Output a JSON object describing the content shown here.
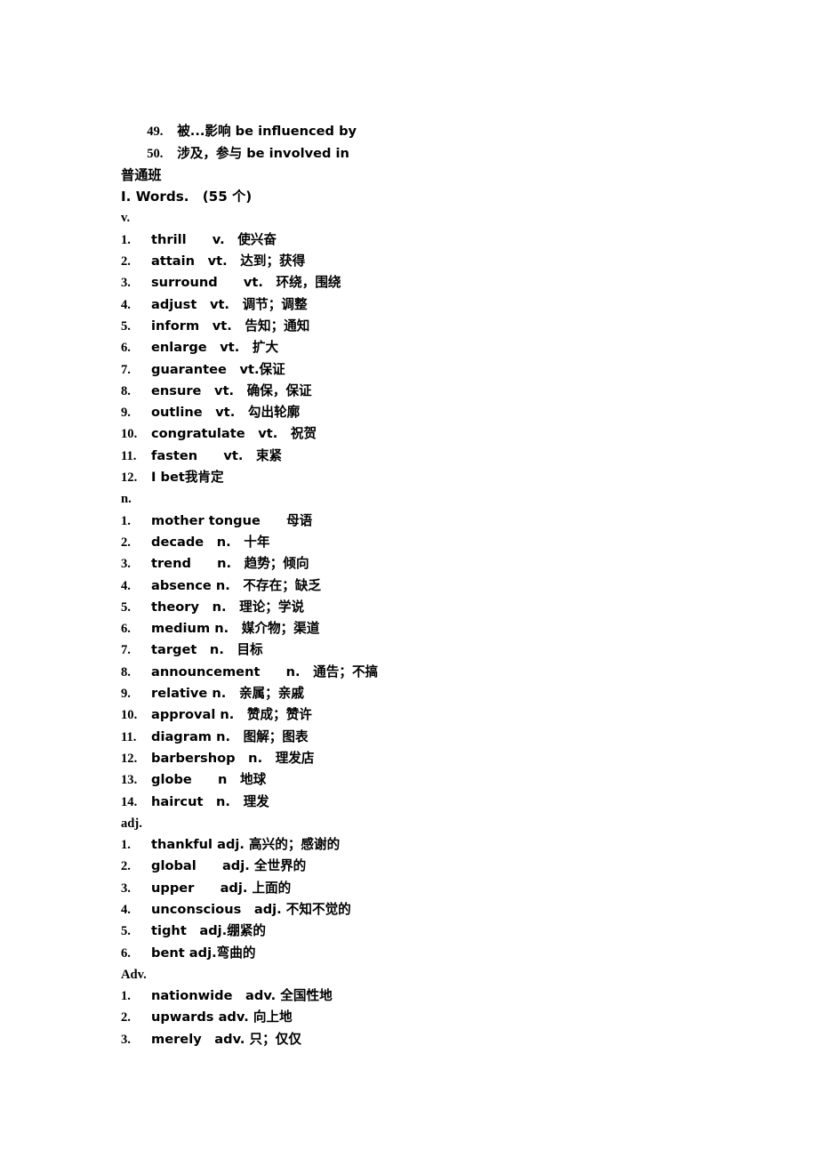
{
  "document": {
    "class_label": "普通班",
    "words_heading": "I. Words.　(55 个)"
  },
  "carryover_phrases": [
    {
      "num": "49.",
      "text": "被...影响 be influenced by"
    },
    {
      "num": "50.",
      "text": "涉及，参与 be involved in"
    }
  ],
  "sections": [
    {
      "heading": "v.",
      "items": [
        {
          "num": "1.",
          "text": "thrill　　v.　使兴奋"
        },
        {
          "num": "2.",
          "text": "attain　vt.　达到；获得"
        },
        {
          "num": "3.",
          "text": "surround　　vt.　环绕，围绕"
        },
        {
          "num": "4.",
          "text": "adjust　vt.　调节；调整"
        },
        {
          "num": "5.",
          "text": "inform　vt.　告知；通知"
        },
        {
          "num": "6.",
          "text": "enlarge　vt.　扩大"
        },
        {
          "num": "7.",
          "text": "guarantee　vt.保证"
        },
        {
          "num": "8.",
          "text": "ensure　vt.　确保，保证"
        },
        {
          "num": "9.",
          "text": "outline　vt.　勾出轮廓"
        },
        {
          "num": "10.",
          "text": "congratulate　vt.　祝贺"
        },
        {
          "num": "11.",
          "text": "fasten　　vt.　束紧"
        },
        {
          "num": "12.",
          "text": "I bet我肯定"
        }
      ]
    },
    {
      "heading": "n.",
      "items": [
        {
          "num": "1.",
          "text": "mother tongue　　母语"
        },
        {
          "num": "2.",
          "text": "decade　n.　十年"
        },
        {
          "num": "3.",
          "text": "trend　　n.　趋势；倾向"
        },
        {
          "num": "4.",
          "text": "absence n.　不存在；缺乏"
        },
        {
          "num": "5.",
          "text": "theory　n.　理论；学说"
        },
        {
          "num": "6.",
          "text": "medium n.　媒介物；渠道"
        },
        {
          "num": "7.",
          "text": "target　n.　目标"
        },
        {
          "num": "8.",
          "text": "announcement　　n.　通告；不搞"
        },
        {
          "num": "9.",
          "text": "relative n.　亲属；亲戚"
        },
        {
          "num": "10.",
          "text": "approval n.　赞成；赞许"
        },
        {
          "num": "11.",
          "text": "diagram n.　图解；图表"
        },
        {
          "num": "12.",
          "text": "barbershop　n.　理发店"
        },
        {
          "num": "13.",
          "text": "globe　　n　地球"
        },
        {
          "num": "14.",
          "text": "haircut　n.　理发"
        }
      ]
    },
    {
      "heading": "adj.",
      "items": [
        {
          "num": "1.",
          "text": "thankful adj. 高兴的；感谢的"
        },
        {
          "num": "2.",
          "text": "global　　adj. 全世界的"
        },
        {
          "num": "3.",
          "text": "upper　　adj. 上面的"
        },
        {
          "num": "4.",
          "text": "unconscious　adj. 不知不觉的"
        },
        {
          "num": "5.",
          "text": "tight　adj.绷紧的"
        },
        {
          "num": "6.",
          "text": "bent adj.弯曲的"
        }
      ]
    },
    {
      "heading": "Adv.",
      "items": [
        {
          "num": "1.",
          "text": "nationwide　adv. 全国性地"
        },
        {
          "num": "2.",
          "text": "upwards adv. 向上地"
        },
        {
          "num": "3.",
          "text": "merely　adv. 只；仅仅"
        }
      ]
    }
  ]
}
